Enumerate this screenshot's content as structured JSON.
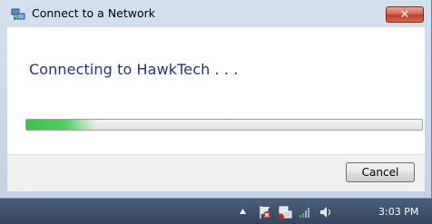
{
  "window": {
    "title": "Connect to a Network",
    "close_glyph": "✕",
    "icon": "network-connect-icon"
  },
  "main": {
    "heading": "Connecting to HawkTech . . .",
    "progress_fraction": 0.18
  },
  "footer": {
    "cancel_label": "Cancel"
  },
  "taskbar": {
    "tray_icons": [
      "show-hidden-icons-arrow",
      "action-center-flag-icon",
      "network-icon",
      "wireless-signal-icon",
      "speaker-icon"
    ],
    "clock": "3:03 PM"
  },
  "colors": {
    "heading": "#1e3287",
    "progress": "#37c24a",
    "close": "#c23b22"
  }
}
